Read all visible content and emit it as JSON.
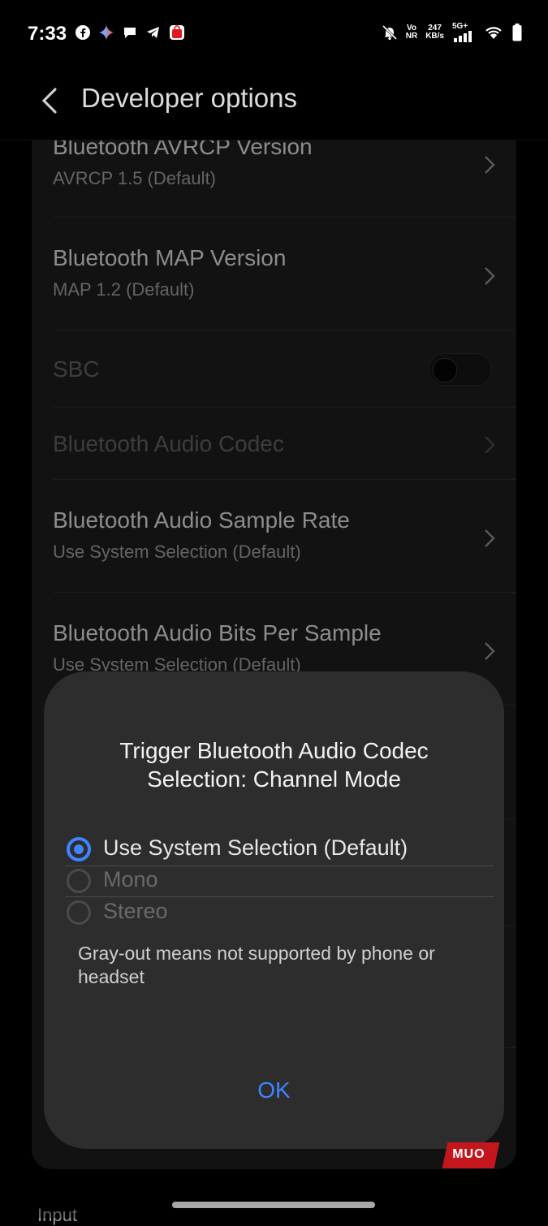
{
  "status_bar": {
    "time": "7:33",
    "net_top": "Vo",
    "net_bottom": "NR",
    "speed_top": "247",
    "speed_bottom": "KB/s",
    "signal": "5G+"
  },
  "header": {
    "title": "Developer options"
  },
  "rows": [
    {
      "title": "Bluetooth AVRCP Version",
      "subtitle": "AVRCP 1.5 (Default)"
    },
    {
      "title": "Bluetooth MAP Version",
      "subtitle": "MAP 1.2 (Default)"
    },
    {
      "title": "SBC"
    },
    {
      "title": "Bluetooth Audio Codec"
    },
    {
      "title": "Bluetooth Audio Sample Rate",
      "subtitle": "Use System Selection (Default)"
    },
    {
      "title": "Bluetooth Audio Bits Per Sample",
      "subtitle": "Use System Selection (Default)"
    }
  ],
  "dialog": {
    "title": "Trigger Bluetooth Audio Codec Selection: Channel Mode",
    "options": [
      {
        "label": "Use System Selection (Default)",
        "selected": true
      },
      {
        "label": "Mono",
        "selected": false
      },
      {
        "label": "Stereo",
        "selected": false
      }
    ],
    "note": "Gray-out means not supported by phone or headset",
    "ok": "OK"
  },
  "section_label": "Input",
  "watermark": "MUO",
  "colors": {
    "accent": "#3f84ff",
    "dialog_bg": "#2d2d2d",
    "card_bg": "#1c1c1c"
  }
}
